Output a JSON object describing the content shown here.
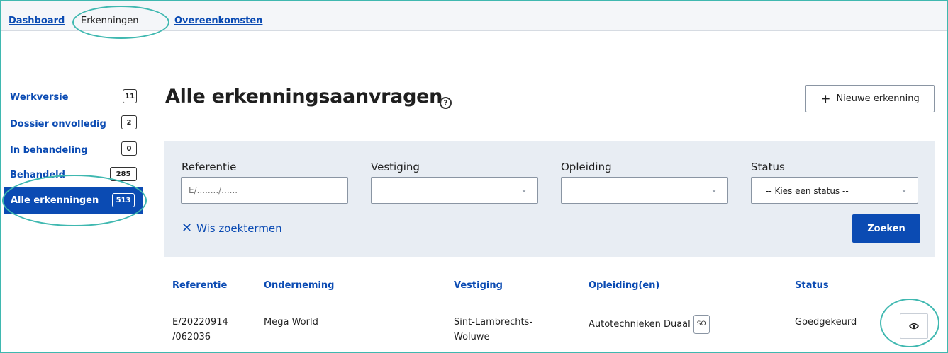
{
  "topnav": {
    "dashboard": "Dashboard",
    "erkenningen": "Erkenningen",
    "overeenkomsten": "Overeenkomsten"
  },
  "sidebar": {
    "items": [
      {
        "label": "Werkversie",
        "count": "11"
      },
      {
        "label": "Dossier onvolledig",
        "count": "2"
      },
      {
        "label": "In behandeling",
        "count": "0"
      },
      {
        "label": "Behandeld",
        "count": "285"
      },
      {
        "label": "Alle erkenningen",
        "count": "513"
      }
    ]
  },
  "main": {
    "title": "Alle erkenningsaanvragen",
    "help_icon": "?",
    "new_button": "Nieuwe erkenning"
  },
  "filters": {
    "referentie_label": "Referentie",
    "referentie_placeholder": "E/......../......",
    "vestiging_label": "Vestiging",
    "vestiging_value": "",
    "opleiding_label": "Opleiding",
    "opleiding_value": "",
    "status_label": "Status",
    "status_value": "-- Kies een status --",
    "clear_label": "Wis zoektermen",
    "search_label": "Zoeken"
  },
  "table": {
    "headers": [
      "Referentie",
      "Onderneming",
      "Vestiging",
      "Opleiding(en)",
      "Status"
    ],
    "rows": [
      {
        "referentie_1": "E/20220914",
        "referentie_2": "/062036",
        "onderneming": "Mega World",
        "vestiging_1": "Sint-Lambrechts-",
        "vestiging_2": "Woluwe",
        "opleiding": "Autotechnieken Duaal",
        "opleiding_tag": "SO",
        "status": "Goedgekeurd"
      }
    ]
  },
  "colors": {
    "accent_blue": "#0b4bb3",
    "highlight_teal": "#3fb8b0",
    "panel_bg": "#e8edf3"
  },
  "icons": [
    "help-circle-icon",
    "plus-icon",
    "chevron-down-icon",
    "close-icon",
    "eye-icon"
  ]
}
